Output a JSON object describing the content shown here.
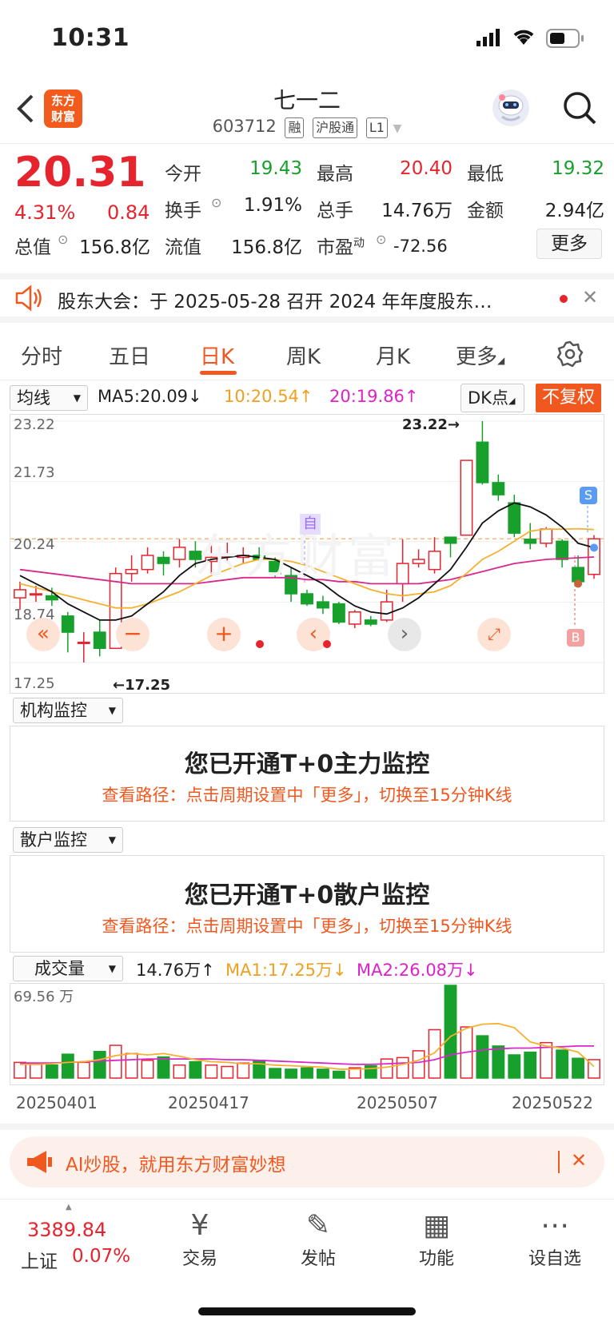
{
  "status": {
    "time": "10:31"
  },
  "header": {
    "name": "七一二",
    "code": "603712",
    "tags": [
      "融",
      "沪股通",
      "L1"
    ],
    "logo_text": "东方财富"
  },
  "quote": {
    "price": "20.31",
    "change_pct": "4.31%",
    "change": "0.84",
    "items": [
      {
        "label": "今开",
        "value": "19.43",
        "color": "green"
      },
      {
        "label": "最高",
        "value": "20.40",
        "color": "red"
      },
      {
        "label": "最低",
        "value": "19.32",
        "color": "green"
      },
      {
        "label": "换手",
        "value": "1.91%",
        "color": "black"
      },
      {
        "label": "总手",
        "value": "14.76万",
        "color": "black"
      },
      {
        "label": "金额",
        "value": "2.94亿",
        "color": "black"
      },
      {
        "label": "总值",
        "value": "156.8亿",
        "color": "black"
      },
      {
        "label": "流值",
        "value": "156.8亿",
        "color": "black"
      },
      {
        "label": "市盈",
        "value": "-72.56",
        "color": "black"
      }
    ],
    "pe_sup": "动",
    "more": "更多"
  },
  "notice": {
    "text": "股东大会：于 2025-05-28 召开 2024 年年度股东…"
  },
  "tabs": [
    "分时",
    "五日",
    "日K",
    "周K",
    "月K",
    "更多"
  ],
  "active_tab": "日K",
  "ma_bar": {
    "selector": "均线",
    "ma5": "MA5:20.09↓",
    "ma10": "10:20.54↑",
    "ma20": "20:19.86↑",
    "dk": "DK点",
    "fq": "不复权"
  },
  "kline": {
    "y_labels": [
      "23.22",
      "21.73",
      "20.24",
      "18.74",
      "17.25"
    ],
    "high_label": "23.22→",
    "low_label": "←17.25",
    "marker_self": "自",
    "marker_s": "S",
    "marker_b": "B",
    "watermark": "东方财富"
  },
  "inst_monitor": {
    "selector": "机构监控",
    "title": "您已开通T+0主力监控",
    "sub": "查看路径：点击周期设置中「更多」，切换至15分钟K线"
  },
  "retail_monitor": {
    "selector": "散户监控",
    "title": "您已开通T+0散户监控",
    "sub": "查看路径：点击周期设置中「更多」，切换至15分钟K线"
  },
  "volume": {
    "selector": "成交量",
    "vol": "14.76万↑",
    "ma1": "MA1:17.25万↓",
    "ma2": "MA2:26.08万↓",
    "max_label": "69.56 万",
    "dates": [
      "20250401",
      "20250417",
      "20250507",
      "20250522"
    ]
  },
  "banner": {
    "text": "AI炒股，就用东方财富妙想"
  },
  "nav": {
    "index_value": "3389.84",
    "index_name": "上证",
    "index_change": "0.07%",
    "items": [
      "交易",
      "发帖",
      "功能",
      "设自选"
    ]
  },
  "chart_data": {
    "type": "candlestick",
    "candles": [
      [
        18.85,
        19.05,
        18.55,
        19.25
      ],
      [
        18.95,
        18.95,
        18.75,
        19.15
      ],
      [
        18.9,
        18.8,
        18.65,
        19.1
      ],
      [
        18.4,
        18.0,
        17.5,
        18.5
      ],
      [
        17.75,
        17.75,
        17.25,
        18.0
      ],
      [
        18.0,
        17.6,
        17.4,
        18.3
      ],
      [
        17.6,
        19.45,
        17.6,
        19.6
      ],
      [
        19.45,
        19.55,
        19.25,
        19.9
      ],
      [
        19.55,
        19.9,
        19.45,
        20.1
      ],
      [
        19.85,
        19.7,
        19.4,
        20.0
      ],
      [
        19.8,
        20.1,
        19.6,
        20.3
      ],
      [
        20.0,
        19.8,
        19.6,
        20.25
      ],
      [
        19.75,
        19.85,
        19.45,
        20.2
      ],
      [
        19.9,
        19.9,
        19.7,
        20.3
      ],
      [
        19.85,
        19.9,
        19.7,
        20.1
      ],
      [
        19.9,
        19.8,
        19.6,
        20.1
      ],
      [
        19.75,
        19.45,
        19.35,
        19.85
      ],
      [
        19.4,
        18.95,
        18.75,
        19.6
      ],
      [
        18.95,
        18.7,
        18.65,
        19.05
      ],
      [
        18.75,
        18.6,
        18.45,
        18.9
      ],
      [
        18.7,
        18.25,
        18.2,
        18.75
      ],
      [
        18.2,
        18.5,
        18.1,
        18.55
      ],
      [
        18.3,
        18.2,
        18.15,
        18.4
      ],
      [
        18.3,
        18.75,
        18.25,
        19.05
      ],
      [
        19.2,
        19.7,
        18.75,
        20.3
      ],
      [
        19.7,
        19.8,
        19.6,
        20.05
      ],
      [
        19.55,
        20.0,
        19.45,
        20.35
      ],
      [
        20.35,
        20.2,
        19.85,
        20.35
      ],
      [
        20.4,
        22.25,
        20.4,
        22.25
      ],
      [
        22.7,
        21.7,
        21.65,
        23.22
      ],
      [
        21.7,
        21.4,
        21.25,
        21.9
      ],
      [
        21.2,
        20.45,
        20.35,
        21.4
      ],
      [
        20.3,
        20.2,
        20.05,
        20.7
      ],
      [
        20.2,
        20.55,
        20.1,
        20.6
      ],
      [
        20.25,
        19.8,
        19.6,
        20.3
      ],
      [
        19.6,
        19.25,
        19.15,
        19.9
      ],
      [
        19.43,
        20.31,
        19.32,
        20.4
      ]
    ],
    "ma5": [
      19.4,
      19.2,
      19.0,
      18.7,
      18.5,
      18.3,
      18.3,
      18.4,
      18.7,
      19.0,
      19.4,
      19.7,
      19.8,
      19.85,
      19.9,
      19.85,
      19.8,
      19.6,
      19.4,
      19.2,
      18.9,
      18.65,
      18.5,
      18.45,
      18.6,
      18.85,
      19.2,
      19.55,
      20.1,
      20.7,
      21.0,
      21.2,
      21.1,
      20.9,
      20.6,
      20.2,
      20.09
    ],
    "ma10": [
      19.2,
      19.1,
      19.0,
      18.9,
      18.8,
      18.7,
      18.6,
      18.6,
      18.7,
      18.85,
      19.0,
      19.2,
      19.4,
      19.55,
      19.7,
      19.8,
      19.8,
      19.75,
      19.65,
      19.5,
      19.35,
      19.2,
      19.05,
      18.95,
      18.9,
      18.95,
      19.0,
      19.15,
      19.45,
      19.8,
      20.0,
      20.25,
      20.5,
      20.55,
      20.55,
      20.56,
      20.54
    ],
    "ma20": [
      19.55,
      19.5,
      19.45,
      19.4,
      19.35,
      19.3,
      19.25,
      19.2,
      19.2,
      19.2,
      19.2,
      19.2,
      19.25,
      19.3,
      19.35,
      19.35,
      19.35,
      19.35,
      19.3,
      19.3,
      19.25,
      19.25,
      19.2,
      19.2,
      19.2,
      19.2,
      19.25,
      19.3,
      19.4,
      19.5,
      19.6,
      19.7,
      19.75,
      19.8,
      19.82,
      19.84,
      19.86
    ],
    "volume": [
      2.3,
      2.0,
      1.9,
      3.5,
      2.3,
      3.9,
      4.8,
      3.6,
      2.6,
      3.1,
      1.9,
      2.4,
      1.9,
      1.7,
      2.2,
      2.6,
      1.4,
      1.3,
      1.5,
      1.3,
      1.0,
      1.5,
      1.8,
      2.8,
      3.0,
      4.0,
      7.1,
      13.6,
      7.5,
      6.2,
      4.7,
      3.4,
      3.8,
      5.2,
      4.1,
      2.9,
      2.7
    ],
    "ma1_vol": [
      2.0,
      2.0,
      2.1,
      2.3,
      2.4,
      2.7,
      3.3,
      3.6,
      3.4,
      3.6,
      3.2,
      2.7,
      2.4,
      2.3,
      2.1,
      2.1,
      1.9,
      1.8,
      1.7,
      1.6,
      1.3,
      1.3,
      1.4,
      1.6,
      2.0,
      2.6,
      3.7,
      6.1,
      7.3,
      7.9,
      8.0,
      7.4,
      5.3,
      4.7,
      4.4,
      3.8,
      1.7
    ],
    "ma2_vol": [
      2.2,
      2.2,
      2.2,
      2.3,
      2.4,
      2.5,
      2.6,
      2.7,
      2.8,
      2.8,
      2.8,
      2.8,
      2.8,
      2.7,
      2.7,
      2.6,
      2.5,
      2.4,
      2.3,
      2.2,
      2.1,
      2.0,
      2.0,
      2.1,
      2.2,
      2.3,
      2.7,
      3.4,
      3.8,
      4.1,
      4.3,
      4.4,
      4.4,
      4.5,
      4.6,
      4.7,
      4.7
    ],
    "ylim": [
      17.25,
      23.22
    ],
    "vol_max": "69.56 万"
  }
}
